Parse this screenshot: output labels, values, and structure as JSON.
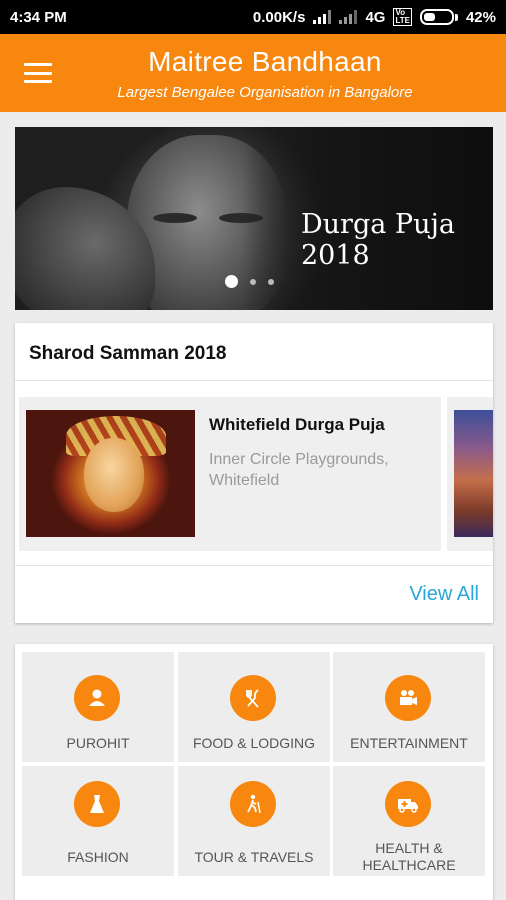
{
  "status_bar": {
    "time": "4:34 PM",
    "speed": "0.00K/s",
    "network": "4G",
    "volte_top": "Vo",
    "volte_bottom": "LTE",
    "battery_percent": "42%",
    "battery_level": 0.42
  },
  "app_bar": {
    "title": "Maitree Bandhaan",
    "subtitle": "Largest Bengalee Organisation in Bangalore",
    "menu_icon": "hamburger-menu-icon",
    "color": "#f7870f"
  },
  "banner": {
    "caption": "Durga Puja 2018",
    "slide_count": 3,
    "active_slide": 1
  },
  "sharod_samman": {
    "title": "Sharod Samman 2018",
    "items": [
      {
        "name": "Whitefield Durga Puja",
        "location": "Inner Circle Playgrounds, Whitefield"
      }
    ],
    "view_all_label": "View All",
    "link_color": "#29a7d8"
  },
  "categories": [
    {
      "label": "PUROHIT",
      "icon": "person-icon"
    },
    {
      "label": "FOOD & LODGING",
      "icon": "fork-knife-icon"
    },
    {
      "label": "ENTERTAINMENT",
      "icon": "video-camera-icon"
    },
    {
      "label": "FASHION",
      "icon": "dress-icon"
    },
    {
      "label": "TOUR & TRAVELS",
      "icon": "hiker-icon"
    },
    {
      "label": "HEALTH & HEALTHCARE",
      "icon": "ambulance-icon"
    }
  ]
}
